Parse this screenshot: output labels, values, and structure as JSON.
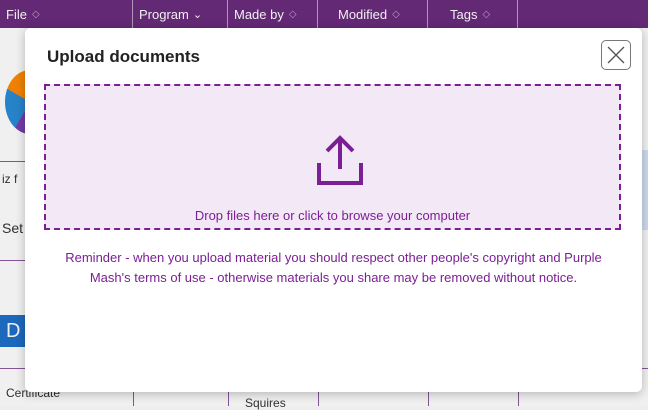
{
  "header": {
    "columns": [
      {
        "label": "File",
        "indicator": "sort"
      },
      {
        "label": "Program",
        "indicator": "dropdown"
      },
      {
        "label": "Made by",
        "indicator": "sort"
      },
      {
        "label": "Modified",
        "indicator": "sort"
      },
      {
        "label": "Tags",
        "indicator": "sort"
      }
    ]
  },
  "background": {
    "partial_text_1": "iz f",
    "partial_text_2": "Set",
    "tile_letter": "D",
    "cert_text": "Certificate",
    "squires_text": "Squires"
  },
  "modal": {
    "title": "Upload documents",
    "close_icon": "close-icon",
    "dropzone": {
      "icon": "upload-icon",
      "text": "Drop files here or click to browse your computer"
    },
    "reminder": "Reminder - when you upload material you should respect other people's copyright and Purple Mash's terms of use - otherwise materials you share may be removed without notice."
  },
  "colors": {
    "header_bg": "#6a2c7d",
    "accent_purple": "#7b1f95",
    "dropzone_bg": "#f3e8f6"
  }
}
